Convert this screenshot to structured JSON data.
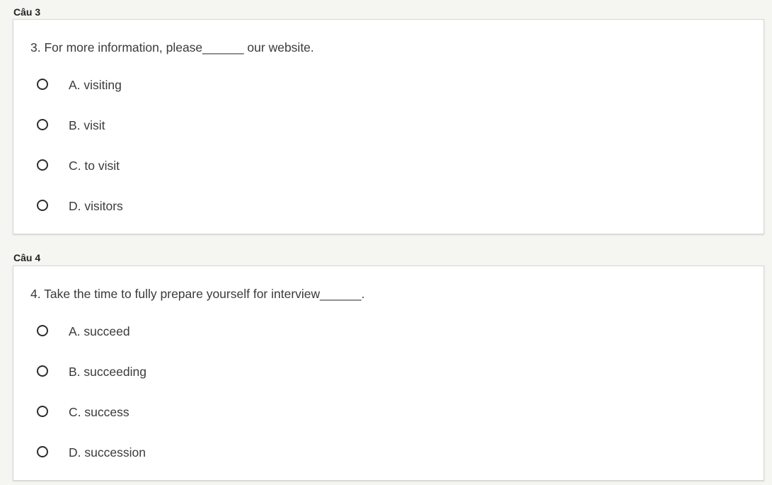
{
  "questions": [
    {
      "label": "Câu 3",
      "text": "3. For more information, please______ our website.",
      "options": [
        "A. visiting",
        "B. visit",
        "C. to visit",
        "D. visitors"
      ]
    },
    {
      "label": "Câu 4",
      "text": "4. Take the time to fully prepare yourself for interview______.",
      "options": [
        "A. succeed",
        "B. succeeding",
        "C. success",
        "D. succession"
      ]
    }
  ]
}
